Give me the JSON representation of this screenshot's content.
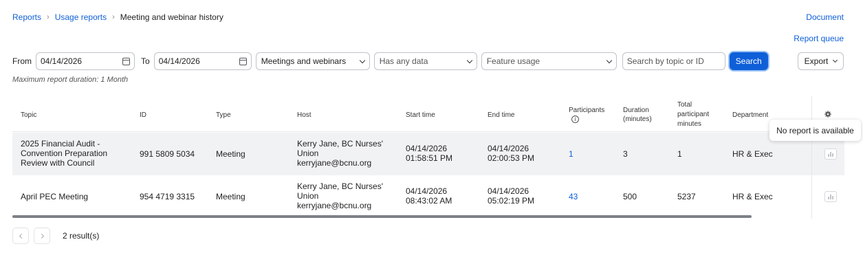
{
  "breadcrumb": {
    "item1": "Reports",
    "item2": "Usage reports",
    "current": "Meeting and webinar history"
  },
  "links": {
    "document": "Document",
    "report_queue": "Report queue"
  },
  "filters": {
    "from_label": "From",
    "from_date": "04/14/2026",
    "to_label": "To",
    "to_date": "04/14/2026",
    "type_select": "Meetings and webinars",
    "data_select": "Has any data",
    "feature_select_placeholder": "Feature usage",
    "search_placeholder": "Search by topic or ID",
    "search_button": "Search",
    "export_button": "Export"
  },
  "note": "Maximum report duration: 1 Month",
  "table": {
    "headers": {
      "topic": "Topic",
      "id": "ID",
      "type": "Type",
      "host": "Host",
      "start": "Start time",
      "end": "End time",
      "participants": "Participants",
      "duration_l1": "Duration",
      "duration_l2": "(minutes)",
      "total_l1": "Total",
      "total_l2": "participant",
      "total_l3": "minutes",
      "department": "Department"
    },
    "rows": [
      {
        "topic_l1": "2025 Financial Audit -",
        "topic_l2": "Convention Preparation",
        "topic_l3": "Review with Council",
        "id": "991 5809 5034",
        "type": "Meeting",
        "host_l1": "Kerry Jane, BC Nurses'",
        "host_l2": "Union",
        "host_l3": "kerryjane@bcnu.org",
        "start_date": "04/14/2026",
        "start_time": "01:58:51 PM",
        "end_date": "04/14/2026",
        "end_time": "02:00:53 PM",
        "participants": "1",
        "duration": "3",
        "total_minutes": "1",
        "department": "HR & Exec"
      },
      {
        "topic_l1": "April PEC Meeting",
        "id": "954 4719 3315",
        "type": "Meeting",
        "host_l1": "Kerry Jane, BC Nurses'",
        "host_l2": "Union",
        "host_l3": "kerryjane@bcnu.org",
        "start_date": "04/14/2026",
        "start_time": "08:43:02 AM",
        "end_date": "04/14/2026",
        "end_time": "05:02:19 PM",
        "participants": "43",
        "duration": "500",
        "total_minutes": "5237",
        "department": "HR & Exec"
      }
    ]
  },
  "tooltip": "No report is available",
  "pagination": {
    "results": "2 result(s)"
  },
  "icons": {
    "calendar": "calendar-icon",
    "chevron": "chevron-down-icon",
    "gear": "gear-icon",
    "info": "info-icon",
    "report": "bar-chart-icon"
  },
  "colors": {
    "accent": "#0e5fd8",
    "row_hover": "#f1f2f4"
  }
}
